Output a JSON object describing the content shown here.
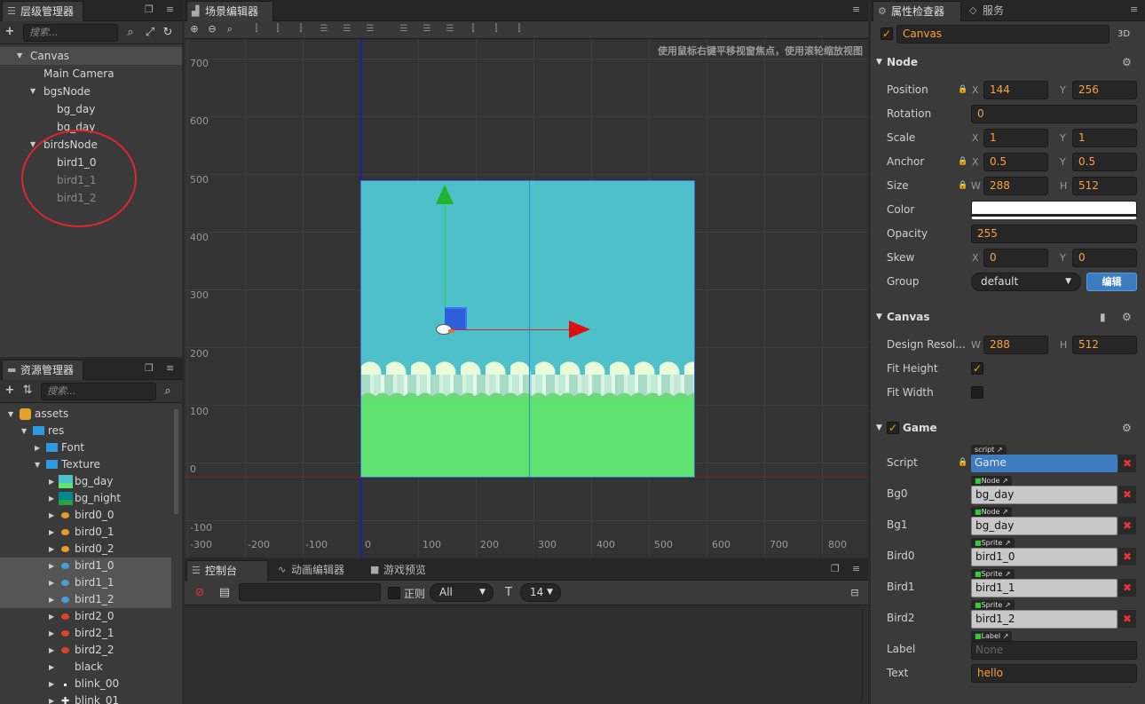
{
  "hierarchy": {
    "title": "层级管理器",
    "search_placeholder": "搜索...",
    "nodes": [
      {
        "label": "Canvas"
      },
      {
        "label": "Main Camera"
      },
      {
        "label": "bgsNode"
      },
      {
        "label": "bg_day"
      },
      {
        "label": "bg_day"
      },
      {
        "label": "birdsNode"
      },
      {
        "label": "bird1_0"
      },
      {
        "label": "bird1_1"
      },
      {
        "label": "bird1_2"
      }
    ]
  },
  "assets": {
    "title": "资源管理器",
    "search_placeholder": "搜索...",
    "items": [
      {
        "label": "assets"
      },
      {
        "label": "res"
      },
      {
        "label": "Font"
      },
      {
        "label": "Texture"
      },
      {
        "label": "bg_day"
      },
      {
        "label": "bg_night"
      },
      {
        "label": "bird0_0"
      },
      {
        "label": "bird0_1"
      },
      {
        "label": "bird0_2"
      },
      {
        "label": "bird1_0"
      },
      {
        "label": "bird1_1"
      },
      {
        "label": "bird1_2"
      },
      {
        "label": "bird2_0"
      },
      {
        "label": "bird2_1"
      },
      {
        "label": "bird2_2"
      },
      {
        "label": "black"
      },
      {
        "label": "blink_00"
      },
      {
        "label": "blink_01"
      }
    ]
  },
  "scene": {
    "title": "场景编辑器",
    "hint": "使用鼠标右键平移视窗焦点，使用滚轮缩放视图",
    "y_ticks": [
      "700",
      "600",
      "500",
      "400",
      "300",
      "200",
      "100",
      "0",
      "-100"
    ],
    "x_ticks": [
      "-300",
      "-200",
      "-100",
      "0",
      "100",
      "200",
      "300",
      "400",
      "500",
      "600",
      "700",
      "800"
    ]
  },
  "console": {
    "tabs": [
      "控制台",
      "动画编辑器",
      "游戏预览"
    ],
    "regex_label": "正则",
    "filter_value": "All",
    "font_size": "14"
  },
  "inspector": {
    "tabs": [
      "属性检查器",
      "服务"
    ],
    "node_name": "Canvas",
    "mode_3d": "3D",
    "node_section": "Node",
    "position": {
      "label": "Position",
      "x": "144",
      "y": "256"
    },
    "rotation": {
      "label": "Rotation",
      "value": "0"
    },
    "scale": {
      "label": "Scale",
      "x": "1",
      "y": "1"
    },
    "anchor": {
      "label": "Anchor",
      "x": "0.5",
      "y": "0.5"
    },
    "size": {
      "label": "Size",
      "w": "288",
      "h": "512"
    },
    "color": {
      "label": "Color",
      "value": "#ffffff"
    },
    "opacity": {
      "label": "Opacity",
      "value": "255"
    },
    "skew": {
      "label": "Skew",
      "x": "0",
      "y": "0"
    },
    "group": {
      "label": "Group",
      "value": "default",
      "edit": "编辑"
    },
    "canvas_section": "Canvas",
    "design_resolution": {
      "label": "Design Resol...",
      "w": "288",
      "h": "512"
    },
    "fit_height": {
      "label": "Fit Height",
      "checked": true
    },
    "fit_width": {
      "label": "Fit Width",
      "checked": false
    },
    "game_section": "Game",
    "script": {
      "label": "Script",
      "tag": "script",
      "value": "Game"
    },
    "bg0": {
      "label": "Bg0",
      "tag": "Node",
      "value": "bg_day"
    },
    "bg1": {
      "label": "Bg1",
      "tag": "Node",
      "value": "bg_day"
    },
    "bird0": {
      "label": "Bird0",
      "tag": "Sprite",
      "value": "bird1_0"
    },
    "bird1": {
      "label": "Bird1",
      "tag": "Sprite",
      "value": "bird1_1"
    },
    "bird2": {
      "label": "Bird2",
      "tag": "Sprite",
      "value": "bird1_2"
    },
    "label": {
      "label": "Label",
      "tag": "Label",
      "value": "None"
    },
    "text": {
      "label": "Text",
      "value": "hello"
    }
  },
  "colors": {
    "accent": "#f5a300",
    "sky": "#4ec0ca",
    "ground": "#5ee270",
    "selection_blue": "#3c7cbf"
  }
}
